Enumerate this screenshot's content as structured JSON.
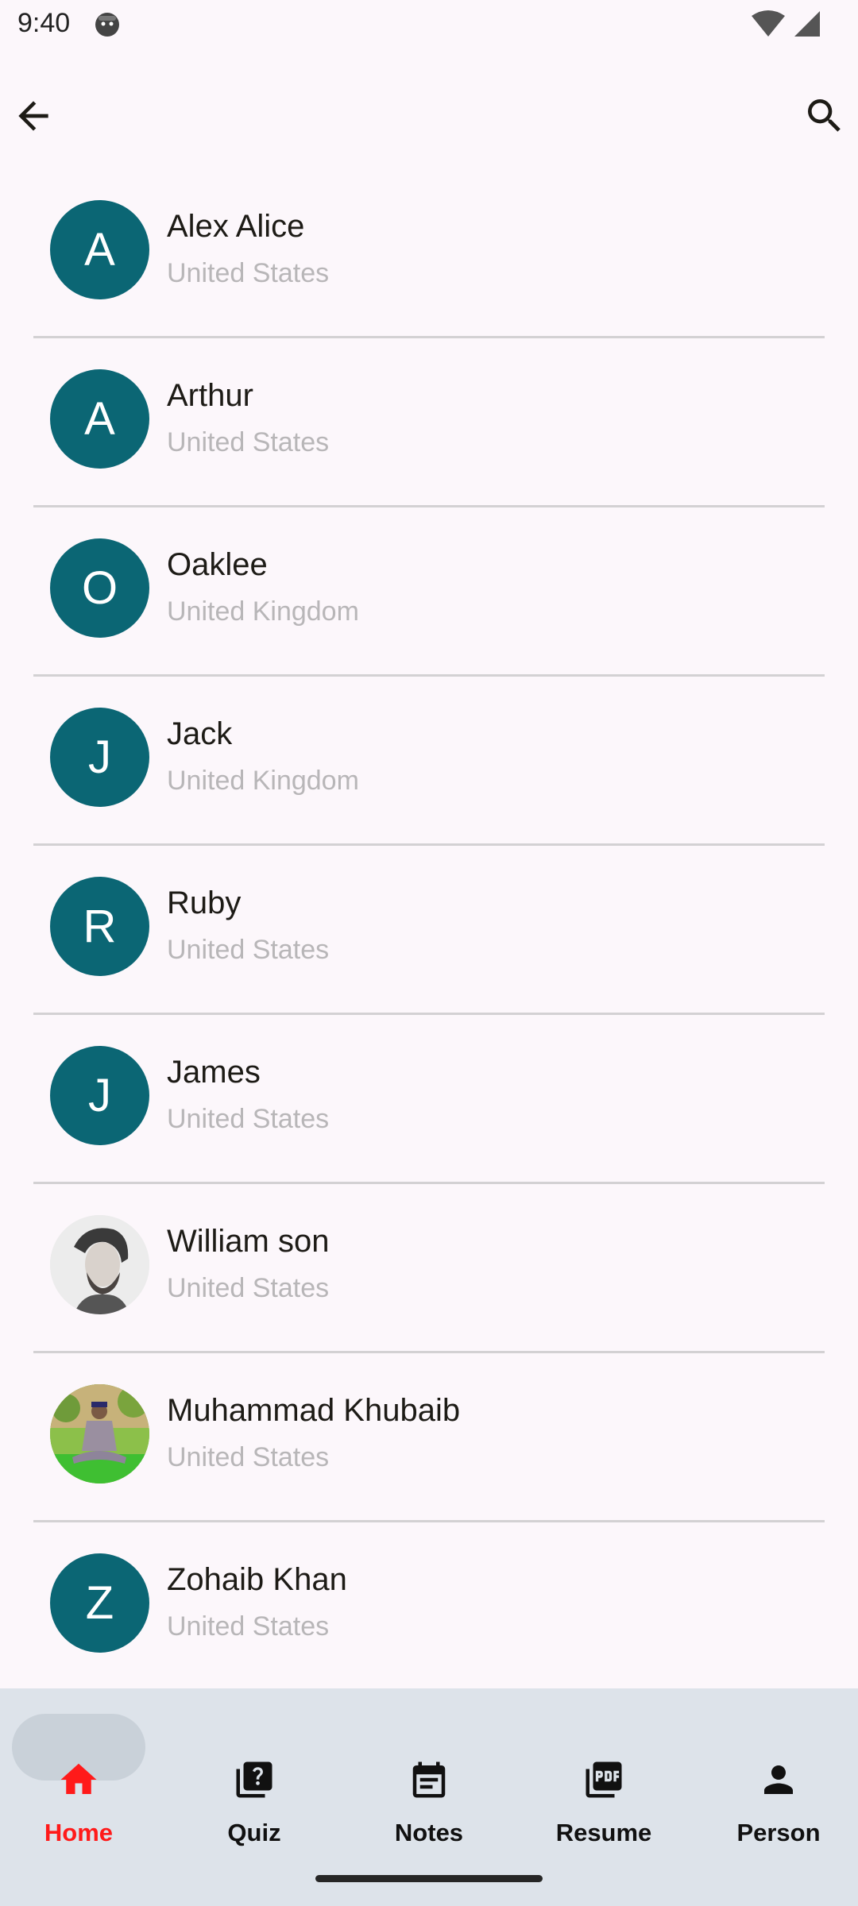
{
  "status": {
    "time": "9:40"
  },
  "contacts": [
    {
      "name": "Alex Alice",
      "country": "United States",
      "initial": "A"
    },
    {
      "name": "Arthur",
      "country": "United States",
      "initial": "A"
    },
    {
      "name": "Oaklee",
      "country": "United Kingdom",
      "initial": "O"
    },
    {
      "name": "Jack",
      "country": "United Kingdom",
      "initial": "J"
    },
    {
      "name": "Ruby",
      "country": "United States",
      "initial": "R"
    },
    {
      "name": "James",
      "country": "United States",
      "initial": "J"
    },
    {
      "name": "William son",
      "country": "United States",
      "avatar": "photo-man-sketch"
    },
    {
      "name": "Muhammad Khubaib",
      "country": "United States",
      "avatar": "photo-boy-outdoor"
    },
    {
      "name": "Zohaib Khan",
      "country": "United States",
      "initial": "Z"
    }
  ],
  "nav": {
    "items": [
      {
        "label": "Home",
        "icon": "home-icon",
        "active": true
      },
      {
        "label": "Quiz",
        "icon": "quiz-icon"
      },
      {
        "label": "Notes",
        "icon": "notes-icon"
      },
      {
        "label": "Resume",
        "icon": "pdf-icon"
      },
      {
        "label": "Person",
        "icon": "person-icon"
      }
    ]
  },
  "colors": {
    "avatar_bg": "#0b6674",
    "active_nav": "#ff1a1a",
    "nav_bg": "#dde3ea"
  }
}
